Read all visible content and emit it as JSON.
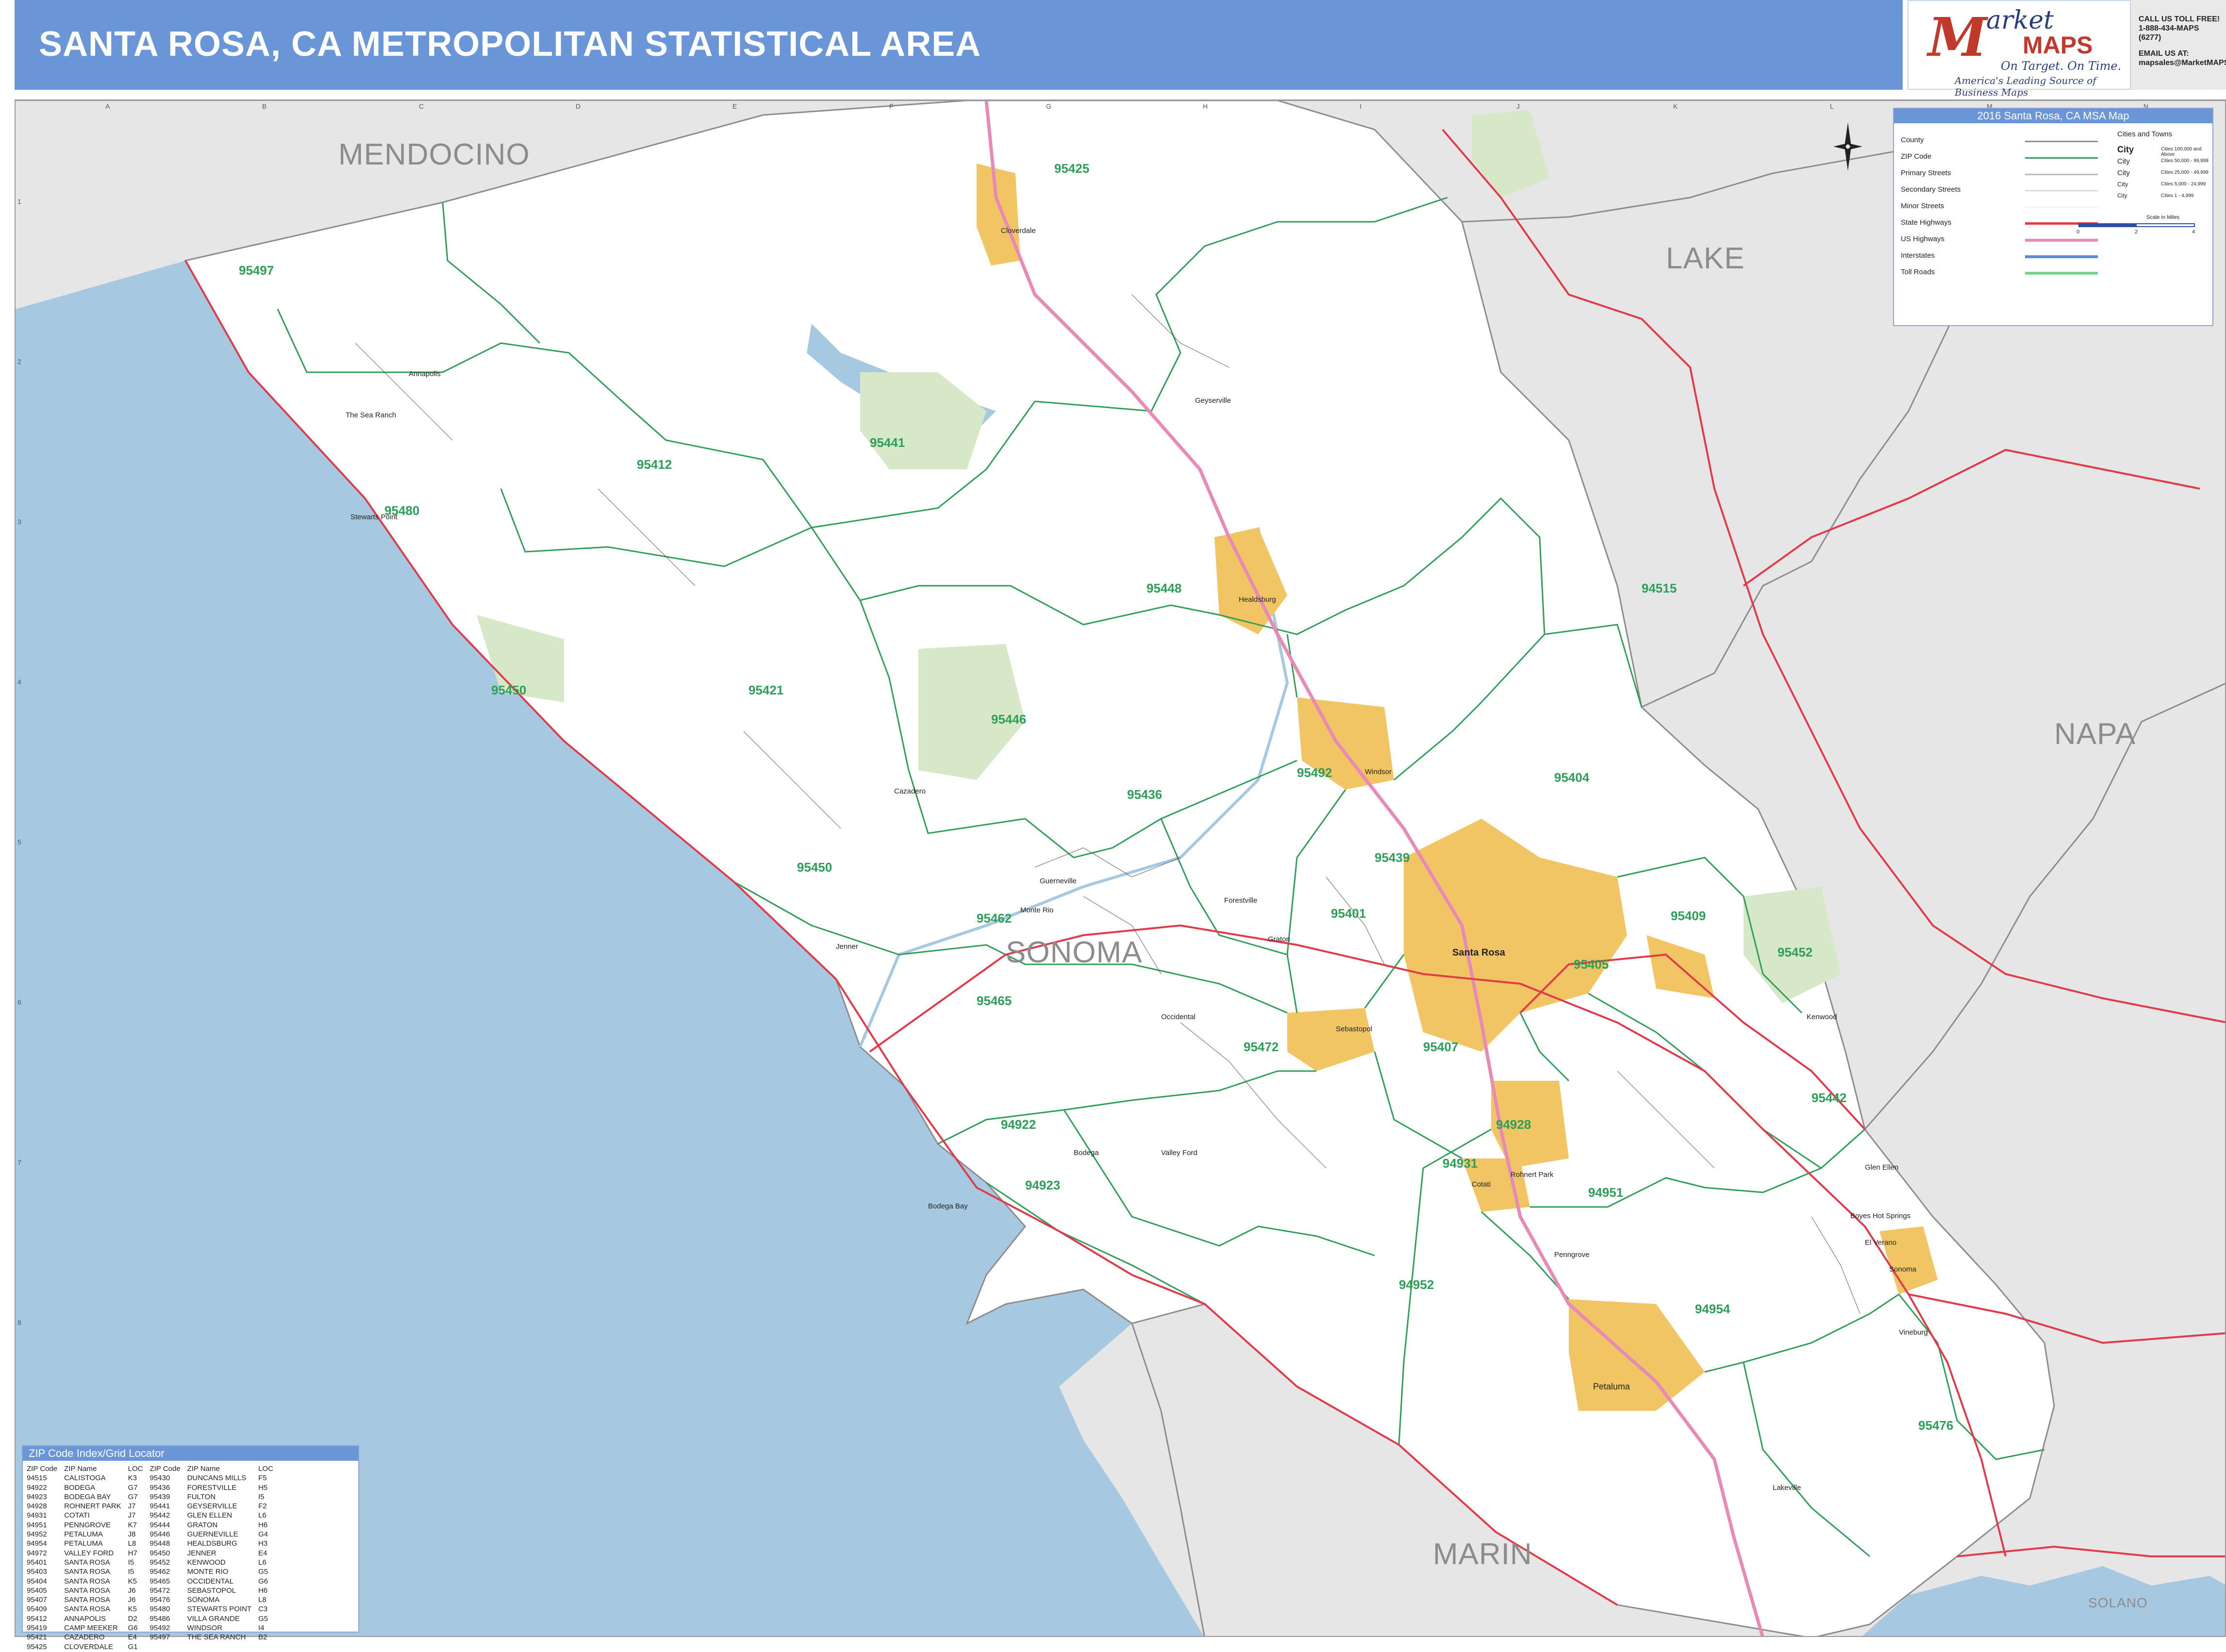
{
  "title": "SANTA ROSA, CA METROPOLITAN STATISTICAL AREA",
  "logo": {
    "letter": "M",
    "brand_top": "arket",
    "brand_bottom": "MAPS",
    "tagline": "On Target. On Time.",
    "subtitle": "America's Leading Source of Business Maps"
  },
  "contact": {
    "call_label": "CALL US TOLL FREE!",
    "phone": "1-888-434-MAPS (6277)",
    "email_label": "EMAIL US AT:",
    "email": "mapsales@MarketMAPS.com"
  },
  "grid": {
    "columns": [
      "A",
      "B",
      "C",
      "D",
      "E",
      "F",
      "G",
      "H",
      "I",
      "J",
      "K",
      "L",
      "M",
      "N"
    ],
    "rows": [
      "1",
      "2",
      "3",
      "4",
      "5",
      "6",
      "7",
      "8"
    ]
  },
  "counties": {
    "mendocino": "MENDOCINO",
    "lake": "LAKE",
    "napa": "NAPA",
    "sonoma": "SONOMA",
    "marin": "MARIN",
    "solano": "SOLANO"
  },
  "zip_labels": {
    "z95425": "95425",
    "z95497": "95497",
    "z95441": "95441",
    "z95412": "95412",
    "z95480": "95480",
    "z95450a": "95450",
    "z95448": "95448",
    "z95515": "94515",
    "z95421": "95421",
    "z95446": "95446",
    "z95492": "95492",
    "z95404": "95404",
    "z95436": "95436",
    "z95450b": "95450",
    "z95439": "95439",
    "z95462": "95462",
    "z95401": "95401",
    "z95409": "95409",
    "z95452": "95452",
    "z95405": "95405",
    "z95465": "95465",
    "z95472": "95472",
    "z95407": "95407",
    "z95442": "95442",
    "z94922": "94922",
    "z94928": "94928",
    "z94931": "94931",
    "z94923": "94923",
    "z94951": "94951",
    "z94952": "94952",
    "z94954": "94954",
    "z95476": "95476"
  },
  "cities": {
    "cloverdale": "Cloverdale",
    "healdsburg": "Healdsburg",
    "windsor": "Windsor",
    "santa_rosa": "Santa Rosa",
    "sebastopol": "Sebastopol",
    "rohnert_park": "Rohnert Park",
    "cotati": "Cotati",
    "petaluma": "Petaluma",
    "sonoma": "Sonoma",
    "guerneville": "Guerneville",
    "bodega_bay": "Bodega Bay",
    "jenner": "Jenner",
    "sea_ranch": "The Sea Ranch",
    "annapolis": "Annapolis",
    "geyserville": "Geyserville",
    "kenwood": "Kenwood",
    "glen_ellen": "Glen Ellen",
    "occidental": "Occidental",
    "monte_rio": "Monte Rio",
    "forestville": "Forestville",
    "graton": "Graton",
    "cazadero": "Cazadero",
    "bodega": "Bodega",
    "valley_ford": "Valley Ford",
    "stewarts_point": "Stewarts Point",
    "penngrove": "Penngrove",
    "boyes_hot_springs": "Boyes Hot Springs",
    "el_verano": "El Verano",
    "vineburg": "Vineburg",
    "lakeville": "Lakeville"
  },
  "legend": {
    "header": "2016 Santa Rosa, CA MSA Map",
    "items": [
      "County",
      "ZIP Code",
      "Primary Streets",
      "Secondary Streets",
      "Minor Streets",
      "State Highways",
      "US Highways",
      "Interstates",
      "Toll Roads"
    ],
    "cities_header": "Cities and Towns",
    "city_sizes": [
      {
        "label": "City",
        "desc": "Cities 100,000 and Above"
      },
      {
        "label": "City",
        "desc": "Cities 50,000 - 99,999"
      },
      {
        "label": "City",
        "desc": "Cities 25,000 - 49,999"
      },
      {
        "label": "City",
        "desc": "Cities 5,000 - 24,999"
      },
      {
        "label": "City",
        "desc": "Cities 1 - 4,999"
      }
    ],
    "scale_label": "Scale in Miles",
    "scale_ticks": [
      "0",
      "2",
      "4"
    ],
    "colors": {
      "county": "#8c8c8c",
      "zip": "#2f9e58",
      "primary": "#bbbbbb",
      "state_hwy": "#e03b4a",
      "us_hwy": "#e88ab6",
      "interstate": "#5a8ad8",
      "toll": "#7ed28f"
    }
  },
  "zip_index": {
    "header": "ZIP Code Index/Grid Locator",
    "columns": [
      "ZIP Code",
      "ZIP Name",
      "LOC",
      "ZIP Code",
      "ZIP Name",
      "LOC"
    ],
    "rows": [
      [
        "94515",
        "CALISTOGA",
        "K3",
        "95430",
        "DUNCANS MILLS",
        "F5"
      ],
      [
        "94922",
        "BODEGA",
        "G7",
        "95436",
        "FORESTVILLE",
        "H5"
      ],
      [
        "94923",
        "BODEGA BAY",
        "G7",
        "95439",
        "FULTON",
        "I5"
      ],
      [
        "94928",
        "ROHNERT PARK",
        "J7",
        "95441",
        "GEYSERVILLE",
        "F2"
      ],
      [
        "94931",
        "COTATI",
        "J7",
        "95442",
        "GLEN ELLEN",
        "L6"
      ],
      [
        "94951",
        "PENNGROVE",
        "K7",
        "95444",
        "GRATON",
        "H6"
      ],
      [
        "94952",
        "PETALUMA",
        "J8",
        "95446",
        "GUERNEVILLE",
        "G4"
      ],
      [
        "94954",
        "PETALUMA",
        "L8",
        "95448",
        "HEALDSBURG",
        "H3"
      ],
      [
        "94972",
        "VALLEY FORD",
        "H7",
        "95450",
        "JENNER",
        "E4"
      ],
      [
        "95401",
        "SANTA ROSA",
        "I5",
        "95452",
        "KENWOOD",
        "L6"
      ],
      [
        "95403",
        "SANTA ROSA",
        "I5",
        "95462",
        "MONTE RIO",
        "G5"
      ],
      [
        "95404",
        "SANTA ROSA",
        "K5",
        "95465",
        "OCCIDENTAL",
        "G6"
      ],
      [
        "95405",
        "SANTA ROSA",
        "J6",
        "95472",
        "SEBASTOPOL",
        "H6"
      ],
      [
        "95407",
        "SANTA ROSA",
        "J6",
        "95476",
        "SONOMA",
        "L8"
      ],
      [
        "95409",
        "SANTA ROSA",
        "K5",
        "95480",
        "STEWARTS POINT",
        "C3"
      ],
      [
        "95412",
        "ANNAPOLIS",
        "D2",
        "95486",
        "VILLA GRANDE",
        "G5"
      ],
      [
        "95419",
        "CAMP MEEKER",
        "G6",
        "95492",
        "WINDSOR",
        "I4"
      ],
      [
        "95421",
        "CAZADERO",
        "E4",
        "95497",
        "THE SEA RANCH",
        "B2"
      ],
      [
        "95425",
        "CLOVERDALE",
        "G1",
        "",
        "",
        ""
      ]
    ]
  }
}
